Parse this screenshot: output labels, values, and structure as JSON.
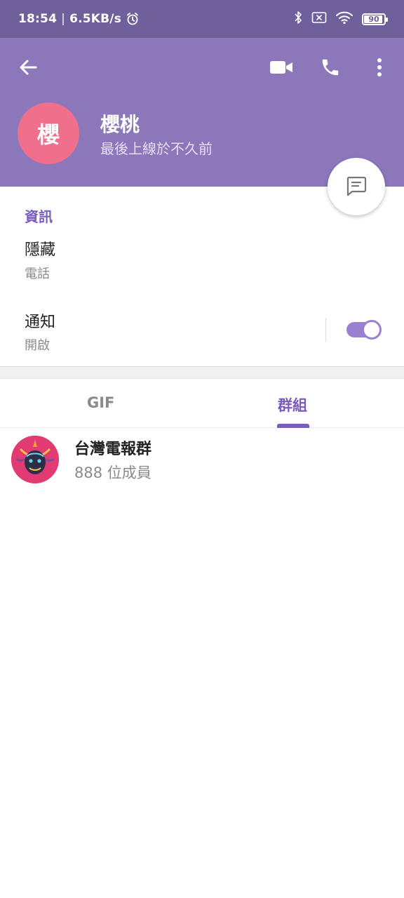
{
  "status_bar": {
    "time": "18:54",
    "separator": "|",
    "net_speed": "6.5KB/s",
    "battery": "90",
    "icons": [
      "alarm-icon",
      "bluetooth-icon",
      "no-sim-icon",
      "wifi-icon",
      "battery-icon"
    ]
  },
  "header": {
    "avatar_initial": "櫻",
    "name": "櫻桃",
    "last_seen": "最後上線於不久前",
    "icons": [
      "back-arrow-icon",
      "video-camera-icon",
      "phone-icon",
      "more-vertical-icon",
      "message-icon"
    ]
  },
  "colors": {
    "status_bar": "#6f5f9a",
    "header": "#8c77bb",
    "avatar": "#ef6f8d",
    "accent": "#7a5cc0",
    "toggle": "#9a80d0"
  },
  "info": {
    "section_title": "資訊",
    "phone_value": "隱藏",
    "phone_label": "電話",
    "notifications_label": "通知",
    "notifications_value": "開啟",
    "notifications_on": true
  },
  "tabs": [
    {
      "label": "GIF",
      "active": false
    },
    {
      "label": "群組",
      "active": true
    }
  ],
  "groups": [
    {
      "name": "台灣電報群",
      "members": "888 位成員"
    }
  ]
}
